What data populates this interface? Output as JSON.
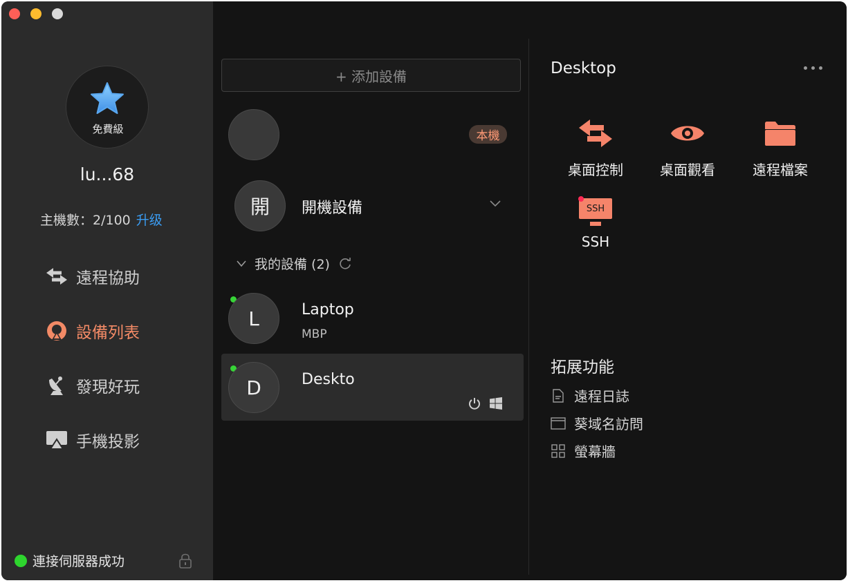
{
  "sidebar": {
    "avatar_tier": "免費級",
    "username": "lu...68",
    "host_count_label": "主機數：2/100",
    "upgrade_label": "升级",
    "nav": [
      {
        "label": "遠程協助",
        "icon": "arrows-swap-icon",
        "active": false
      },
      {
        "label": "設備列表",
        "icon": "device-list-icon",
        "active": true
      },
      {
        "label": "發現好玩",
        "icon": "satellite-dish-icon",
        "active": false
      },
      {
        "label": "手機投影",
        "icon": "airplay-icon",
        "active": false
      }
    ],
    "status_text": "連接伺服器成功",
    "status_color": "#2ed52e"
  },
  "device_list": {
    "add_button_label": "+ 添加設備",
    "local_badge": "本機",
    "boot_device": {
      "avatar_letter": "開",
      "title": "開機設備"
    },
    "section_title": "我的設備 (2)",
    "devices": [
      {
        "avatar_letter": "L",
        "name": "Laptop",
        "subtitle": "MBP",
        "online": true
      },
      {
        "avatar_letter": "D",
        "name": "Deskto",
        "subtitle": "",
        "online": true
      }
    ]
  },
  "detail": {
    "device_name": "Desktop",
    "actions": [
      {
        "label": "桌面控制",
        "icon": "remote-control-icon"
      },
      {
        "label": "桌面觀看",
        "icon": "eye-icon"
      },
      {
        "label": "遠程檔案",
        "icon": "folder-icon"
      },
      {
        "label": "SSH",
        "icon": "ssh-terminal-icon",
        "icon_text": "SSH"
      }
    ],
    "extensions_title": "拓展功能",
    "extensions": [
      {
        "label": "遠程日誌",
        "icon": "document-icon"
      },
      {
        "label": "葵域名訪問",
        "icon": "browser-window-icon"
      },
      {
        "label": "螢幕牆",
        "icon": "grid-icon"
      }
    ],
    "accent_color": "#f5846a"
  }
}
